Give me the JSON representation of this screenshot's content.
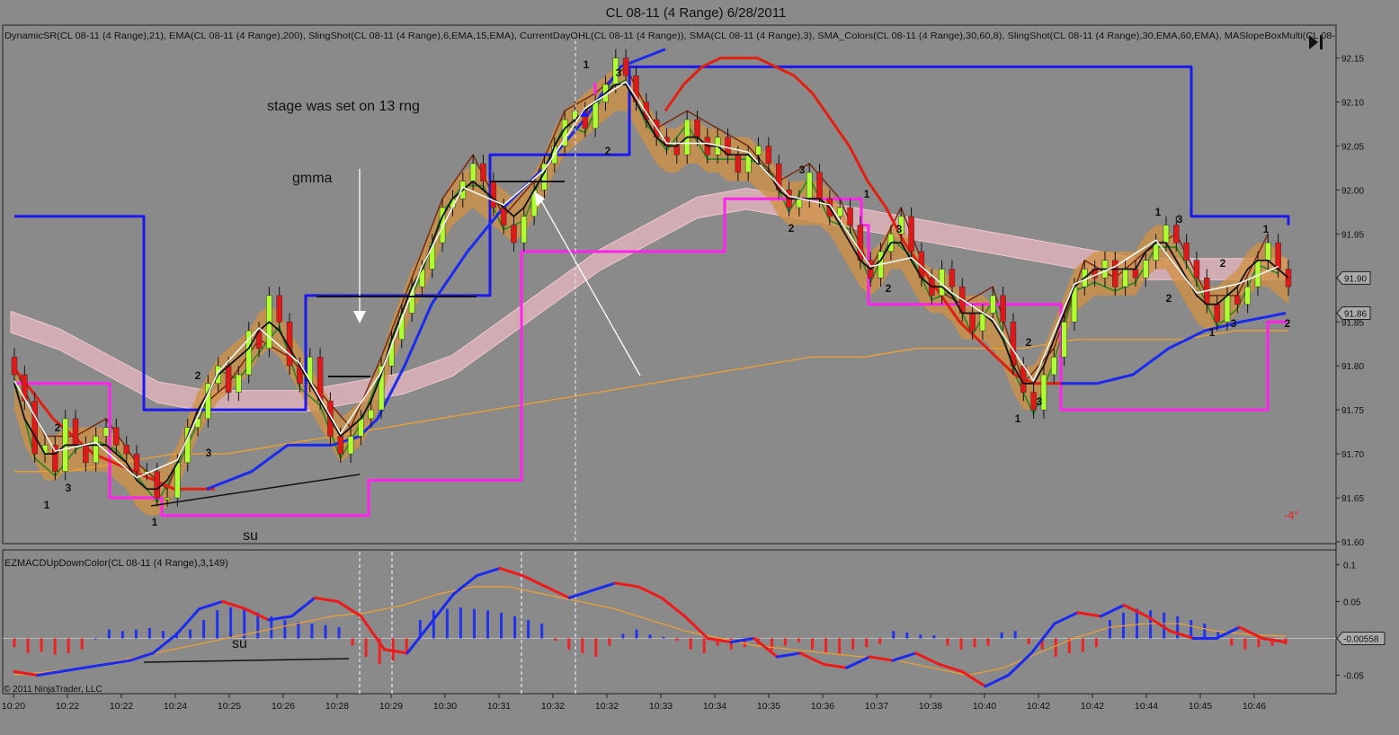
{
  "window_title": "CL 08-11 (4 Range)  6/28/2011",
  "indicator_line": "DynamicSR(CL 08-11 (4 Range),21), EMA(CL 08-11 (4 Range),200), SlingShot(CL 08-11 (4 Range),6,EMA,15,EMA), CurrentDayOHL(CL 08-11 (4 Range)), SMA(CL 08-11 (4 Range),3), SMA_Colors(CL 08-11 (4 Range),30,60,8), SlingShot(CL 08-11 (4 Range),30,EMA,60,EMA), MASlopeBoxMulti(CL 08-",
  "macd_label": "EZMACDUpDownColor(CL 08-11 (4 Range),3,149)",
  "copyright": "© 2011 NinjaTrader, LLC",
  "slope_readout": "-4°",
  "colors": {
    "background": "#8a8a8a",
    "up_bar": "#adff2f",
    "down_bar": "#e01818",
    "dynamic_sr": "#1a1aee",
    "current_day_ohl": "#ff22ee",
    "ema200": "#f0a030",
    "slingshot_fast": "#e02010",
    "slingshot_slow": "#1a2aee",
    "sma3": "#111111",
    "white_line": "#ffffff"
  },
  "annotations": {
    "stage": "stage was set on 13 rng",
    "gmma": "gmma",
    "su_price": "su",
    "su_macd": "su"
  },
  "chart_data": [
    {
      "type": "candlestick",
      "title": "CL 08-11 (4 Range)  6/28/2011",
      "xlabel": "",
      "ylabel": "",
      "ylim": [
        91.6,
        92.17
      ],
      "yticks": [
        "92.15",
        "92.10",
        "92.05",
        "92.00",
        "91.95",
        "91.90",
        "91.85",
        "91.80",
        "91.75",
        "91.70",
        "91.65",
        "91.60"
      ],
      "last_price_labels": [
        "91.90",
        "91.86"
      ],
      "xticks": [
        "10:20",
        "10:22",
        "10:22",
        "10:24",
        "10:25",
        "10:26",
        "10:28",
        "10:29",
        "10:30",
        "10:31",
        "10:32",
        "10:32",
        "10:33",
        "10:34",
        "10:35",
        "10:36",
        "10:37",
        "10:38",
        "10:40",
        "10:42",
        "10:42",
        "10:44",
        "10:45",
        "10:46"
      ],
      "series": [
        {
          "name": "Close",
          "values": [
            91.79,
            91.76,
            91.7,
            91.71,
            91.68,
            91.74,
            91.71,
            91.69,
            91.72,
            91.73,
            91.71,
            91.7,
            91.68,
            91.68,
            91.65,
            91.65,
            91.69,
            91.73,
            91.74,
            91.78,
            91.8,
            91.77,
            91.79,
            91.84,
            91.82,
            91.88,
            91.85,
            91.8,
            91.78,
            91.81,
            91.76,
            91.72,
            91.7,
            91.72,
            91.74,
            91.75,
            91.8,
            91.83,
            91.86,
            91.89,
            91.91,
            91.94,
            91.98,
            91.99,
            92.01,
            92.03,
            92.01,
            91.98,
            91.96,
            91.94,
            91.97,
            92.0,
            92.03,
            92.05,
            92.08,
            92.09,
            92.07,
            92.1,
            92.12,
            92.15,
            92.13,
            92.1,
            92.08,
            92.06,
            92.05,
            92.04,
            92.08,
            92.06,
            92.04,
            92.06,
            92.04,
            92.02,
            92.04,
            92.05,
            92.03,
            92.0,
            91.98,
            91.99,
            92.02,
            91.99,
            91.97,
            91.98,
            91.96,
            91.92,
            91.9,
            91.93,
            91.95,
            91.97,
            91.93,
            91.9,
            91.88,
            91.91,
            91.89,
            91.86,
            91.84,
            91.86,
            91.88,
            91.85,
            91.8,
            91.77,
            91.75,
            91.79,
            91.81,
            91.85,
            91.89,
            91.91,
            91.9,
            91.92,
            91.89,
            91.91,
            91.9,
            91.92,
            91.94,
            91.96,
            91.94,
            91.92,
            91.9,
            91.87,
            91.85,
            91.88,
            91.87,
            91.89,
            91.92,
            91.94,
            91.91,
            91.89
          ]
        },
        {
          "name": "SMA(3)",
          "values": [
            91.78,
            91.74,
            91.72,
            91.7,
            91.7,
            91.71,
            91.71,
            91.71,
            91.71,
            91.71,
            91.7,
            91.69,
            91.67,
            91.66,
            91.66,
            91.67,
            91.69,
            91.72,
            91.75,
            91.77,
            91.79,
            91.8,
            91.81,
            91.82,
            91.84,
            91.85,
            91.84,
            91.82,
            91.8,
            91.78,
            91.76,
            91.74,
            91.72,
            91.73,
            91.74,
            91.76,
            91.79,
            91.83,
            91.86,
            91.89,
            91.91,
            91.94,
            91.97,
            91.99,
            92.0,
            92.01,
            92.0,
            91.99,
            91.98,
            91.97,
            91.98,
            92.0,
            92.02,
            92.05,
            92.07,
            92.08,
            92.09,
            92.1,
            92.11,
            92.12,
            92.12,
            92.1,
            92.08,
            92.06,
            92.05,
            92.05,
            92.06,
            92.06,
            92.05,
            92.05,
            92.04,
            92.04,
            92.04,
            92.03,
            92.02,
            92.0,
            91.99,
            91.99,
            91.99,
            91.99,
            91.98,
            91.96,
            91.94,
            91.92,
            91.91,
            91.92,
            91.94,
            91.94,
            91.92,
            91.9,
            91.89,
            91.89,
            91.88,
            91.86,
            91.86,
            91.86,
            91.85,
            91.83,
            91.8,
            91.78,
            91.78,
            91.8,
            91.83,
            91.86,
            91.89,
            91.9,
            91.91,
            91.91,
            91.91,
            91.91,
            91.91,
            91.93,
            91.94,
            91.94,
            91.92,
            91.9,
            91.88,
            91.87,
            91.87,
            91.88,
            91.89,
            91.91,
            91.92,
            91.92,
            91.91,
            91.9
          ]
        },
        {
          "name": "SlingShot fast (EMA 6/15)",
          "values": [
            91.8,
            91.78,
            91.76,
            91.74,
            91.73,
            91.72,
            91.72,
            91.71,
            91.7,
            91.7,
            91.69,
            91.69,
            91.68,
            91.68,
            91.67,
            91.67,
            91.66,
            91.66,
            91.66,
            91.66,
            91.66,
            91.67,
            91.68,
            91.69,
            91.7,
            91.71,
            91.73,
            91.76,
            91.8,
            91.85,
            91.9,
            91.95,
            92.0,
            92.05,
            92.09,
            92.12,
            92.14,
            92.15,
            92.15,
            92.15,
            92.14,
            92.13,
            92.11,
            92.08,
            92.05,
            92.01,
            91.98,
            91.94,
            91.91,
            91.88,
            91.85,
            91.83,
            91.81,
            91.79,
            91.78,
            91.78,
            91.78
          ]
        },
        {
          "name": "SlingShot slow (EMA 30/60)",
          "values": [
            91.65,
            91.66,
            91.67,
            91.69,
            91.7,
            91.72,
            91.75,
            91.8,
            91.86,
            91.92,
            91.98,
            92.04,
            92.09,
            92.11,
            92.1,
            92.09,
            92.08,
            92.06,
            92.05,
            92.03,
            92.0,
            91.97,
            91.95,
            91.93,
            91.92,
            91.9,
            91.88,
            91.86,
            91.84,
            91.82,
            91.81,
            91.78,
            91.78,
            91.79,
            91.8,
            91.82,
            91.84,
            91.85,
            91.86
          ]
        },
        {
          "name": "EMA(200)",
          "values": [
            91.68,
            91.68,
            91.69,
            91.7,
            91.7,
            91.71,
            91.72,
            91.73,
            91.74,
            91.75,
            91.76,
            91.77,
            91.78,
            91.79,
            91.8,
            91.81,
            91.81,
            91.82,
            91.82,
            91.82,
            91.83,
            91.83,
            91.83,
            91.84,
            91.84
          ]
        },
        {
          "name": "DynamicSR",
          "values": [
            91.97,
            91.97,
            91.75,
            91.75,
            91.75,
            91.75,
            91.88,
            91.88,
            91.88,
            92.04,
            92.04,
            92.04,
            92.14,
            92.14,
            92.14,
            92.14,
            92.14,
            92.14,
            92.14,
            92.14,
            92.14,
            91.97,
            91.97,
            91.96
          ]
        },
        {
          "name": "CurrentDayOHL",
          "values": [
            91.78,
            91.78,
            91.65,
            91.63,
            91.63,
            91.63,
            91.67,
            91.67,
            91.93,
            91.93,
            91.93,
            91.99,
            91.96,
            91.87,
            91.87,
            91.75,
            91.75,
            91.75,
            91.85
          ]
        }
      ]
    },
    {
      "type": "bar",
      "title": "EZMACDUpDownColor(CL 08-11 (4 Range),3,149)",
      "ylim": [
        -0.075,
        0.12
      ],
      "yticks": [
        "0.1",
        "0.05",
        "-0.05"
      ],
      "last_value_label": "-0.00558",
      "series": [
        {
          "name": "MACD",
          "values": [
            -0.045,
            -0.05,
            -0.045,
            -0.04,
            -0.035,
            -0.03,
            -0.02,
            0.005,
            0.04,
            0.05,
            0.04,
            0.025,
            0.03,
            0.055,
            0.05,
            0.03,
            -0.015,
            -0.02,
            0.02,
            0.06,
            0.085,
            0.095,
            0.085,
            0.07,
            0.055,
            0.065,
            0.075,
            0.07,
            0.055,
            0.03,
            0.0,
            -0.005,
            0.0,
            -0.025,
            -0.02,
            -0.035,
            -0.04,
            -0.025,
            -0.03,
            -0.02,
            -0.035,
            -0.045,
            -0.065,
            -0.05,
            -0.02,
            0.02,
            0.035,
            0.03,
            0.045,
            0.03,
            0.01,
            0.0,
            0.0,
            0.015,
            0.0,
            -0.005
          ]
        },
        {
          "name": "Signal",
          "values": [
            -0.05,
            -0.045,
            -0.04,
            -0.03,
            -0.02,
            -0.01,
            0.0,
            0.01,
            0.02,
            0.03,
            0.035,
            0.045,
            0.06,
            0.07,
            0.07,
            0.06,
            0.05,
            0.04,
            0.025,
            0.01,
            0.0,
            -0.01,
            -0.015,
            -0.02,
            -0.025,
            -0.03,
            -0.04,
            -0.05,
            -0.04,
            -0.02,
            0.0,
            0.015,
            0.02,
            0.02,
            0.01,
            0.005,
            0.003
          ]
        },
        {
          "name": "Histogram",
          "values": [
            -0.012,
            -0.02,
            -0.018,
            -0.022,
            -0.02,
            -0.015,
            0.0,
            0.012,
            0.01,
            0.012,
            0.014,
            0.01,
            0.008,
            0.012,
            0.025,
            0.038,
            0.042,
            0.04,
            0.035,
            0.03,
            0.025,
            0.022,
            0.02,
            0.018,
            0.015,
            -0.01,
            -0.025,
            -0.035,
            -0.03,
            -0.022,
            0.025,
            0.038,
            0.04,
            0.042,
            0.04,
            0.038,
            0.035,
            0.03,
            0.025,
            0.02,
            -0.003,
            -0.015,
            -0.02,
            -0.025,
            -0.01,
            0.006,
            0.012,
            0.005,
            0.002,
            -0.003,
            -0.015,
            -0.02,
            -0.01,
            -0.015,
            -0.012,
            -0.008,
            -0.016,
            -0.01,
            -0.005,
            -0.015,
            -0.02,
            -0.022,
            -0.015,
            -0.012,
            -0.008,
            0.01,
            0.008,
            0.005,
            0.004,
            -0.01,
            -0.015,
            -0.012,
            -0.01,
            0.008,
            0.01,
            -0.008,
            -0.015,
            -0.025,
            -0.02,
            -0.018,
            -0.012,
            0.025,
            0.035,
            0.04,
            0.038,
            0.035,
            0.03,
            0.025,
            0.02,
            0.01,
            -0.01,
            -0.015,
            -0.012,
            -0.01,
            -0.008
          ]
        }
      ]
    }
  ],
  "swing_labels": [
    {
      "text": "1",
      "x": "10:20",
      "y": 91.63
    },
    {
      "text": "2",
      "x": "10:22",
      "y": 91.74
    },
    {
      "text": "3",
      "x": "10:22",
      "y": 91.66
    },
    {
      "text": "1",
      "x": "10:24",
      "y": 91.62
    },
    {
      "text": "2",
      "x": "10:24",
      "y": 91.79
    },
    {
      "text": "3",
      "x": "10:25",
      "y": 91.7
    },
    {
      "text": "1",
      "x": "10:32",
      "y": 92.16
    },
    {
      "text": "3",
      "x": "10:32",
      "y": 92.15
    },
    {
      "text": "2",
      "x": "10:32",
      "y": 92.05
    },
    {
      "text": "1",
      "x": "10:34",
      "y": 92.04
    },
    {
      "text": "3",
      "x": "10:35",
      "y": 92.03
    },
    {
      "text": "2",
      "x": "10:35",
      "y": 91.96
    },
    {
      "text": "1",
      "x": "10:37",
      "y": 92.0
    },
    {
      "text": "3",
      "x": "10:37",
      "y": 91.96
    },
    {
      "text": "2",
      "x": "10:36",
      "y": 91.9
    },
    {
      "text": "2",
      "x": "10:40",
      "y": 91.82
    },
    {
      "text": "1",
      "x": "10:40",
      "y": 91.74
    },
    {
      "text": "3",
      "x": "10:42",
      "y": 91.76
    },
    {
      "text": "1",
      "x": "10:44",
      "y": 91.98
    },
    {
      "text": "3",
      "x": "10:44",
      "y": 91.98
    },
    {
      "text": "2",
      "x": "10:44",
      "y": 91.89
    },
    {
      "text": "2",
      "x": "10:45",
      "y": 91.92
    },
    {
      "text": "1",
      "x": "10:45",
      "y": 91.85
    },
    {
      "text": "3",
      "x": "10:45",
      "y": 91.86
    },
    {
      "text": "1",
      "x": "10:46",
      "y": 91.96
    },
    {
      "text": "2",
      "x": "10:46",
      "y": 91.86
    }
  ]
}
